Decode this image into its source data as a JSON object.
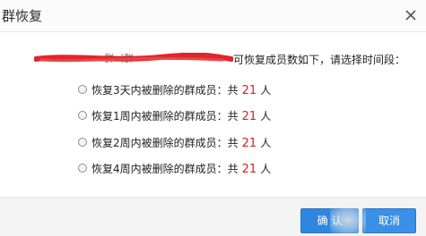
{
  "dialog": {
    "title": "群恢复",
    "close_icon": "close-icon"
  },
  "intro": {
    "group_prefix": "群（群",
    "text": "可恢复成员数如下，请选择时间段："
  },
  "options": [
    {
      "label": "恢复3天内被删除的群成员：共",
      "count": "21",
      "unit": "人"
    },
    {
      "label": "恢复1周内被删除的群成员：共",
      "count": "21",
      "unit": "人"
    },
    {
      "label": "恢复2周内被删除的群成员：共",
      "count": "21",
      "unit": "人"
    },
    {
      "label": "恢复4周内被删除的群成员：共",
      "count": "21",
      "unit": "人"
    }
  ],
  "footer": {
    "confirm_label": "确 认",
    "cancel_label": "取消"
  },
  "colors": {
    "accent": "#2f86e0",
    "count": "#d61f1f",
    "redaction": "#e0262a"
  }
}
